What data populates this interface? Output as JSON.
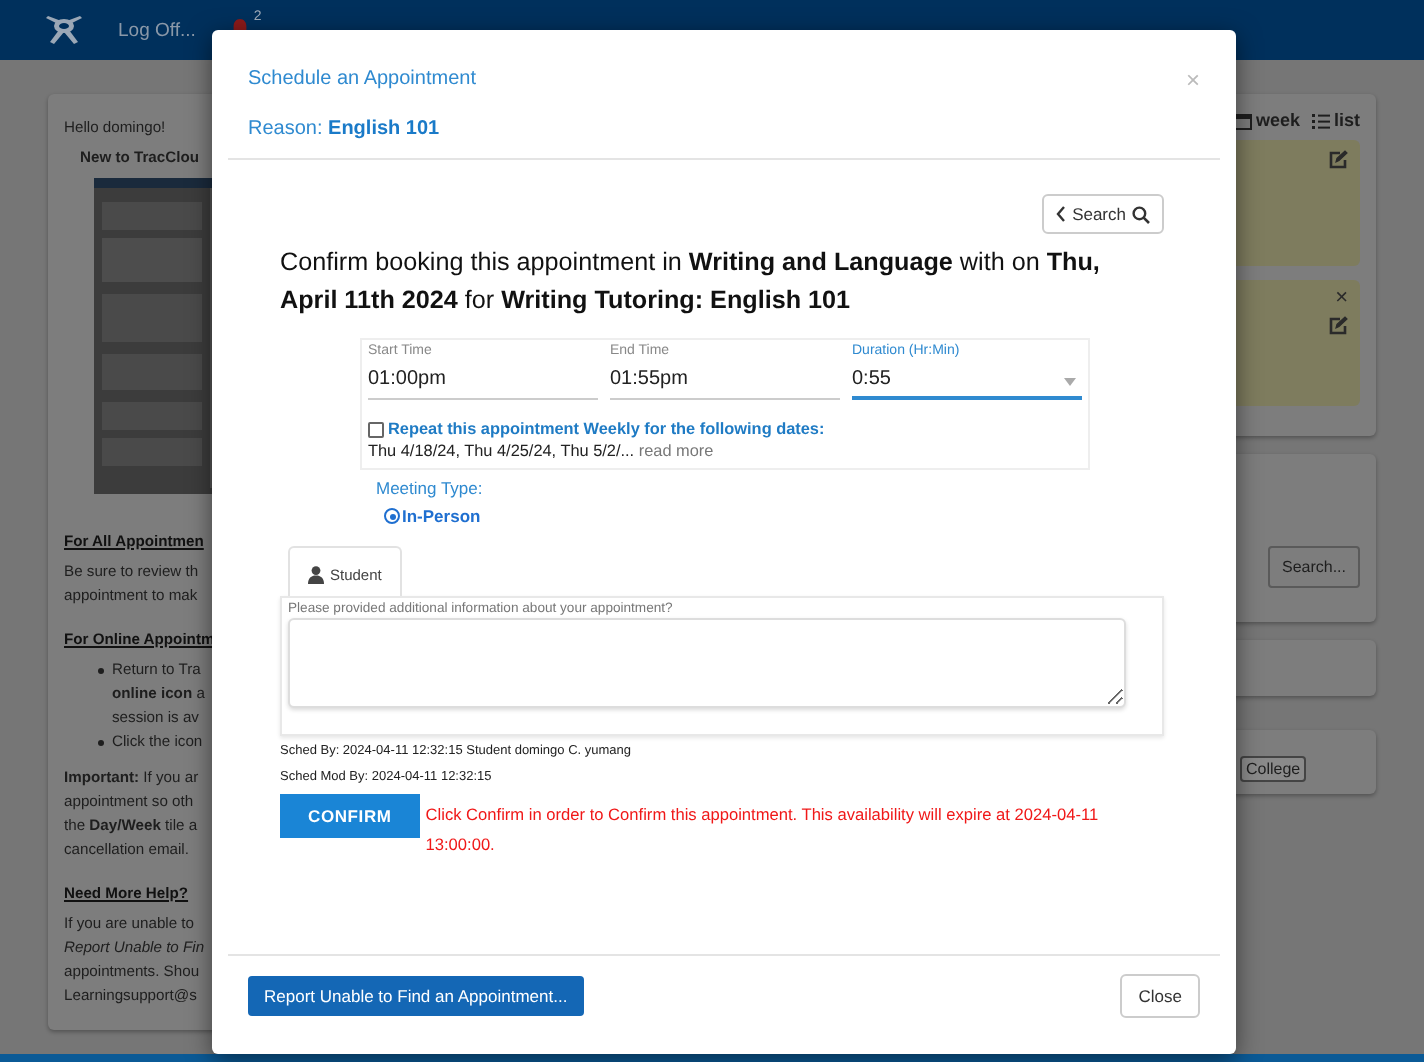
{
  "nav": {
    "user_menu": "Log Off...",
    "notification_count": "2"
  },
  "left_card": {
    "greeting": "Hello domingo!",
    "intro_title": "New to TracClou",
    "lines": [
      {
        "kind": "heading",
        "text": "For All Appointmen"
      },
      {
        "kind": "line",
        "text": "Be sure to review th"
      },
      {
        "kind": "line",
        "text": "appointment to mak"
      },
      {
        "kind": "heading",
        "text": "For Online Appointm"
      },
      {
        "kind": "bullet",
        "text": "Return to Tra"
      },
      {
        "kind": "continued",
        "text": "**online icon** a"
      },
      {
        "kind": "continued",
        "text": "session is av"
      },
      {
        "kind": "bullet",
        "text": "Click the icon"
      },
      {
        "kind": "para",
        "text": "**Important:** If you ar"
      },
      {
        "kind": "line",
        "text": "appointment so oth"
      },
      {
        "kind": "line",
        "text": "the **Day/Week** tile a"
      },
      {
        "kind": "line",
        "text": "cancellation email."
      },
      {
        "kind": "heading",
        "text": "Need More Help?"
      },
      {
        "kind": "line",
        "text": "If you are unable to"
      },
      {
        "kind": "italic",
        "text": "Report Unable to Fin"
      },
      {
        "kind": "line",
        "text": "appointments. Shou"
      },
      {
        "kind": "line",
        "text": "Learningsupport@s"
      }
    ]
  },
  "right_panel": {
    "views": [
      "week",
      "list"
    ],
    "appointments": [
      {
        "closable": false
      },
      {
        "closable": true
      }
    ],
    "search_button": "Search...",
    "college_button": "College"
  },
  "modal": {
    "title": "Schedule an Appointment",
    "reason": "Reason: **English 101**",
    "close_symbol": "×",
    "back_button": "Search",
    "heading": "Confirm booking this appointment in **Writing and Language** with on **Thu, April 11th 2024** for **Writing Tutoring: English 101**",
    "fields": [
      {
        "label": "Start Time",
        "value": "01:00pm",
        "focused": false,
        "kind": "text"
      },
      {
        "label": "End Time",
        "value": "01:55pm",
        "focused": false,
        "kind": "text"
      },
      {
        "label": "Duration (Hr:Min)",
        "value": "0:55",
        "focused": true,
        "kind": "select"
      }
    ],
    "repeat": {
      "checked": false,
      "label": "Repeat this appointment Weekly for the following dates:",
      "dates": "Thu 4/18/24, Thu 4/25/24, Thu 5/2/...",
      "read_more": "read more"
    },
    "meeting_type": {
      "label": "Meeting Type:",
      "options": [
        {
          "label": "In-Person",
          "selected": true
        }
      ]
    },
    "tabs": [
      {
        "label": "Student",
        "selected": true
      }
    ],
    "notes": {
      "label": "Please provided additional information about your appointment?"
    },
    "sched_by": "Sched By: 2024-04-11 12:32:15 Student domingo C. yumang",
    "sched_mod_by": "Sched Mod By: 2024-04-11 12:32:15",
    "confirm_button": "CONFIRM",
    "expiry_message": "Click Confirm in order to Confirm this appointment. This availability will expire at 2024-04-11 13:00:00.",
    "report_button": "Report Unable to Find an Appointment...",
    "close_button": "Close"
  }
}
